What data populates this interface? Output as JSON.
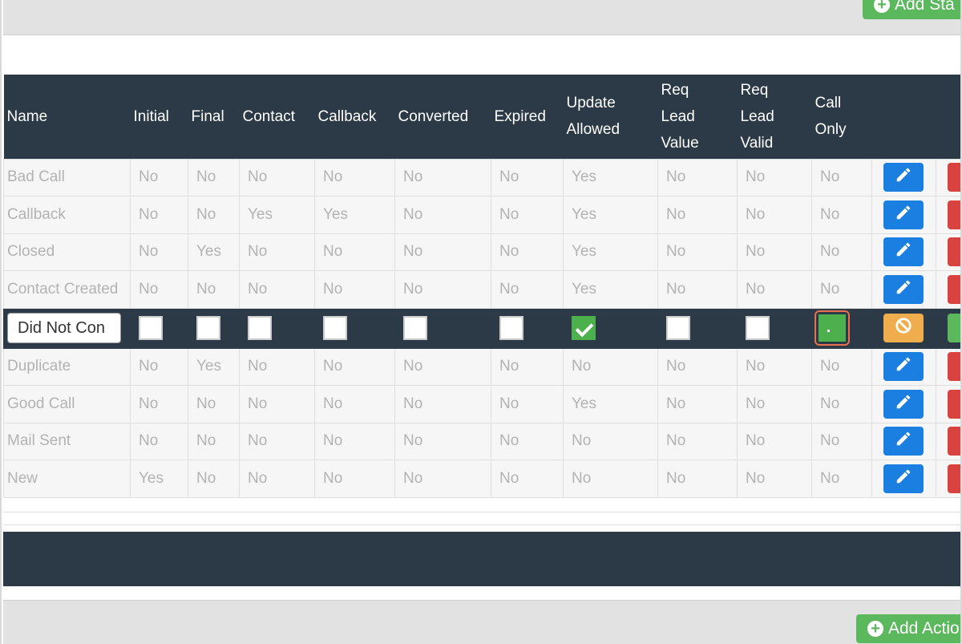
{
  "buttons": {
    "add_status": "Add Sta",
    "add_action": "Add Actio"
  },
  "table": {
    "headers": [
      [
        "Name"
      ],
      [
        "Initial"
      ],
      [
        "Final"
      ],
      [
        "Contact"
      ],
      [
        "Callback"
      ],
      [
        "Converted"
      ],
      [
        "Expired"
      ],
      [
        "Update",
        "Allowed"
      ],
      [
        "Req",
        "Lead",
        "Value"
      ],
      [
        "Req",
        "Lead",
        "Valid"
      ],
      [
        "Call",
        "Only"
      ]
    ],
    "rows": [
      [
        "Bad Call",
        "No",
        "No",
        "No",
        "No",
        "No",
        "No",
        "Yes",
        "No",
        "No",
        "No"
      ],
      [
        "Callback",
        "No",
        "No",
        "Yes",
        "Yes",
        "No",
        "No",
        "Yes",
        "No",
        "No",
        "No"
      ],
      [
        "Closed",
        "No",
        "Yes",
        "No",
        "No",
        "No",
        "No",
        "Yes",
        "No",
        "No",
        "No"
      ],
      [
        "Contact Created",
        "No",
        "No",
        "No",
        "No",
        "No",
        "No",
        "Yes",
        "No",
        "No",
        "No"
      ]
    ],
    "edit_row": {
      "name_value": "Did Not Con",
      "checks": [
        false,
        false,
        false,
        false,
        false,
        false,
        true,
        false,
        false,
        "focused"
      ]
    },
    "rows_after": [
      [
        "Duplicate",
        "No",
        "Yes",
        "No",
        "No",
        "No",
        "No",
        "No",
        "No",
        "No",
        "No"
      ],
      [
        "Good Call",
        "No",
        "No",
        "No",
        "No",
        "No",
        "No",
        "Yes",
        "No",
        "No",
        "No"
      ],
      [
        "Mail Sent",
        "No",
        "No",
        "No",
        "No",
        "No",
        "No",
        "No",
        "No",
        "No",
        "No"
      ],
      [
        "New",
        "Yes",
        "No",
        "No",
        "No",
        "No",
        "No",
        "No",
        "No",
        "No",
        "No"
      ]
    ]
  },
  "icons": {
    "edit": "pencil-icon",
    "delete": "trash-icon",
    "cancel": "ban-icon",
    "save": "check-icon",
    "add": "plus-circle-icon"
  },
  "colors": {
    "header_bg": "#2b3a46",
    "edit_blue": "#1a7fe0",
    "delete_red": "#d9433f",
    "cancel_orange": "#f0ad4e",
    "add_green": "#5cb85c",
    "checkbox_green": "#4cb04c",
    "focus_ring": "#e8704f"
  }
}
